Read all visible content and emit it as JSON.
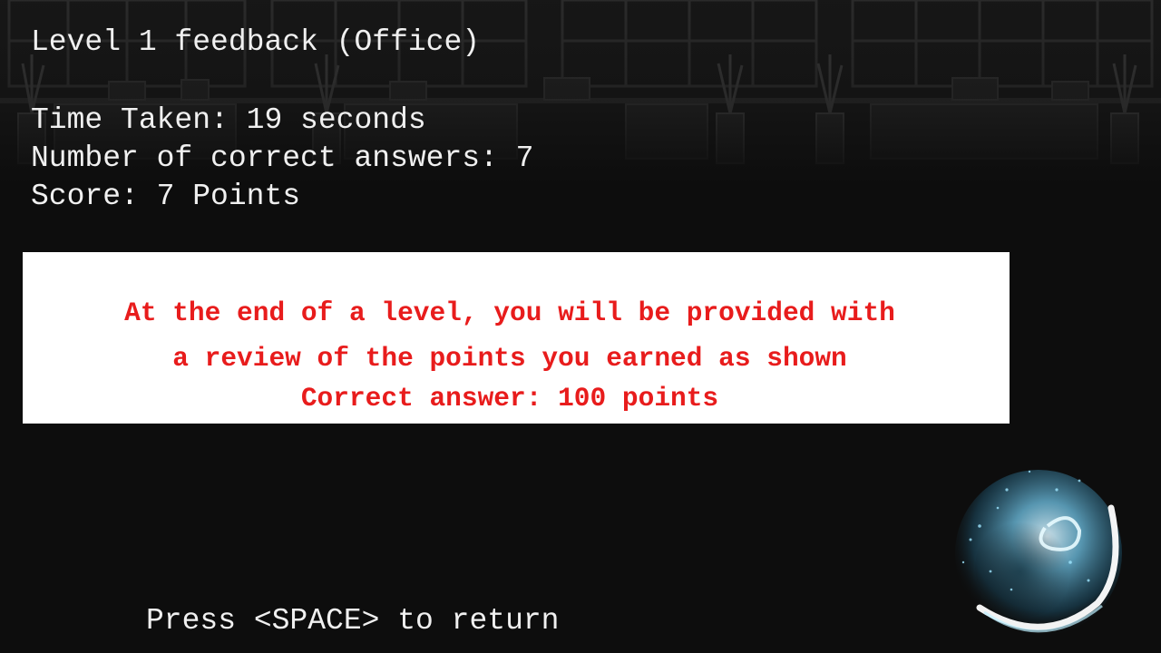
{
  "feedback": {
    "title": "Level 1 feedback (Office)",
    "time_taken": "Time Taken: 19 seconds",
    "correct_answers": "Number of correct answers: 7",
    "score": "Score: 7 Points"
  },
  "tutorial": {
    "line1": "At the end of a level, you will be provided with",
    "line2": "a review of the points you earned as shown",
    "line3": "Correct answer: 100 points"
  },
  "prompt": {
    "return_label": "Press <SPACE> to return"
  },
  "colors": {
    "background": "#0d0d0d",
    "text": "#f0f0f0",
    "tutorial_text": "#e81c1c",
    "tutorial_box": "#ffffff",
    "orb_glow": "#9fe6ff"
  },
  "icons": {
    "orb": "glowing-orb-icon",
    "scene": "office-background"
  }
}
